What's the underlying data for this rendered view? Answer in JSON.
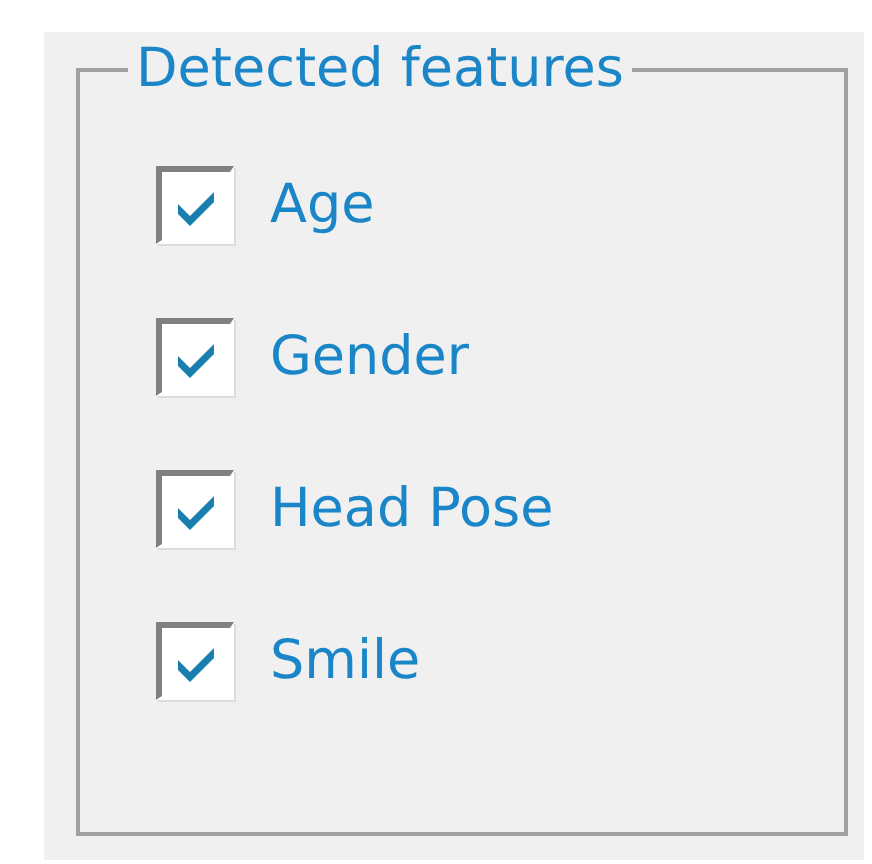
{
  "group": {
    "title": "Detected features",
    "options": [
      {
        "label": "Age",
        "checked": true
      },
      {
        "label": "Gender",
        "checked": true
      },
      {
        "label": "Head Pose",
        "checked": true
      },
      {
        "label": "Smile",
        "checked": true
      }
    ]
  }
}
